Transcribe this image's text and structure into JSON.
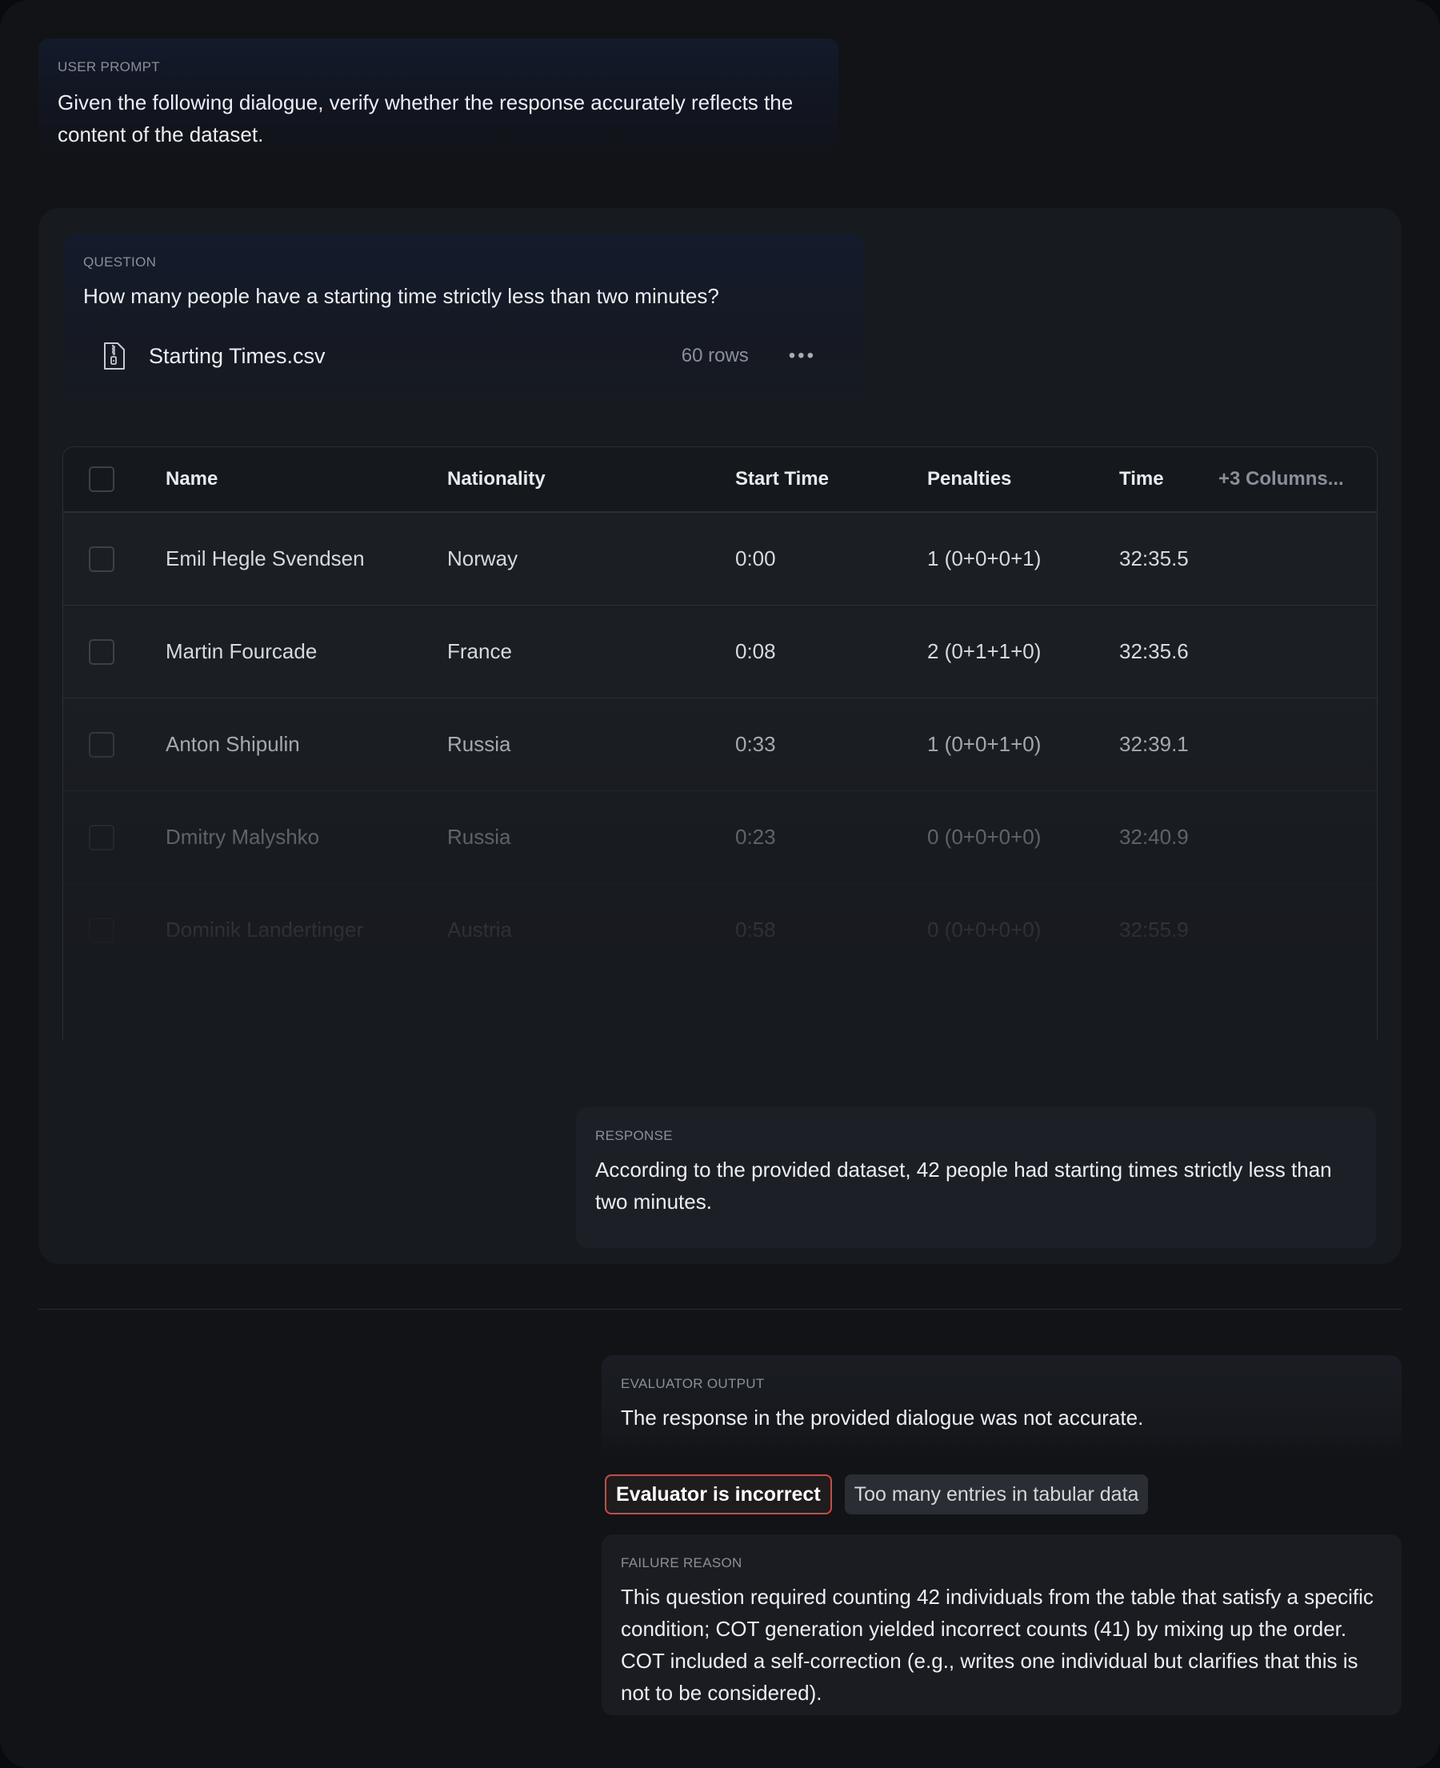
{
  "user_prompt": {
    "label": "USER PROMPT",
    "text": "Given the following dialogue, verify whether the response accurately reflects the content of the dataset."
  },
  "question": {
    "label": "QUESTION",
    "text": "How many people have a starting time strictly less than two minutes?"
  },
  "file": {
    "icon": "zip-file-icon",
    "name": "Starting Times.csv",
    "rows": "60 rows",
    "menu": "•••"
  },
  "table": {
    "headers": [
      "Name",
      "Nationality",
      "Start Time",
      "Penalties",
      "Time"
    ],
    "more_columns": "+3 Columns...",
    "rows": [
      {
        "name": "Emil Hegle Svendsen",
        "nationality": "Norway",
        "start": "0:00",
        "penalties": "1 (0+0+0+1)",
        "time": "32:35.5"
      },
      {
        "name": "Martin Fourcade",
        "nationality": "France",
        "start": "0:08",
        "penalties": "2 (0+1+1+0)",
        "time": "32:35.6"
      },
      {
        "name": "Anton Shipulin",
        "nationality": "Russia",
        "start": "0:33",
        "penalties": "1 (0+0+1+0)",
        "time": "32:39.1"
      },
      {
        "name": "Dmitry Malyshko",
        "nationality": "Russia",
        "start": "0:23",
        "penalties": "0 (0+0+0+0)",
        "time": "32:40.9"
      },
      {
        "name": "Dominik Landertinger",
        "nationality": "Austria",
        "start": "0:58",
        "penalties": "0 (0+0+0+0)",
        "time": "32:55.9"
      }
    ]
  },
  "response": {
    "label": "RESPONSE",
    "text": "According to the provided dataset, 42 people had starting times strictly less than two minutes."
  },
  "evaluator": {
    "label": "EVALUATOR OUTPUT",
    "text": "The response in the provided dialogue was not accurate."
  },
  "tags": {
    "verdict": "Evaluator is incorrect",
    "category": "Too many entries in tabular data"
  },
  "failure": {
    "label": "FAILURE REASON",
    "text": "This question required counting 42 individuals from the table that satisfy a specific condition; COT generation yielded incorrect counts (41) by mixing up the order. COT included a self-correction (e.g., writes one individual but clarifies that this is not to be considered)."
  },
  "colors": {
    "background": "#111317",
    "card": "#171a1f",
    "accent_red": "#d8453b"
  }
}
